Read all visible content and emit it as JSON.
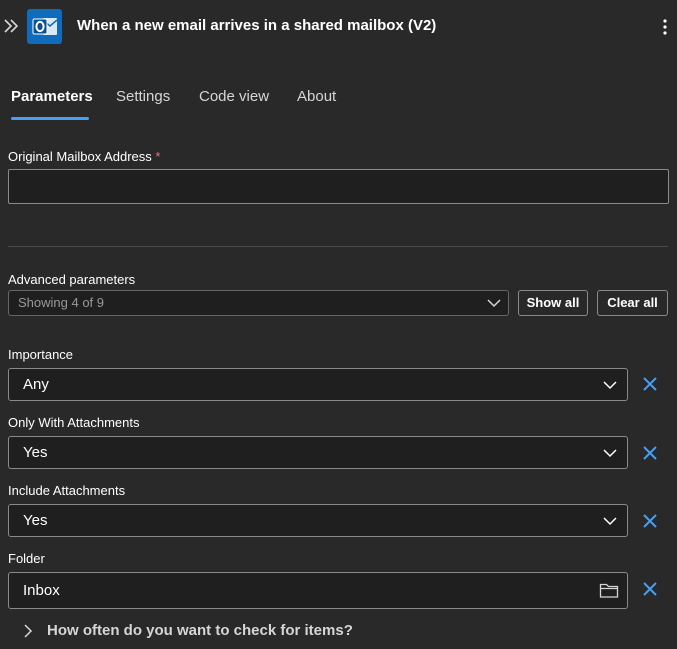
{
  "header": {
    "title": "When a new email arrives in a shared mailbox (V2)",
    "icons": {
      "collapse": "double-chevron-right-icon",
      "app": "outlook-icon",
      "more": "more-vertical-icon"
    }
  },
  "tabs": [
    {
      "label": "Parameters",
      "active": true
    },
    {
      "label": "Settings",
      "active": false
    },
    {
      "label": "Code view",
      "active": false
    },
    {
      "label": "About",
      "active": false
    }
  ],
  "mailbox": {
    "label": "Original Mailbox Address",
    "required_mark": "*",
    "value": ""
  },
  "advanced": {
    "label": "Advanced parameters",
    "selector_text": "Showing 4 of 9",
    "show_all": "Show all",
    "clear_all": "Clear all"
  },
  "params": [
    {
      "label": "Importance",
      "value": "Any",
      "control": "dropdown"
    },
    {
      "label": "Only With Attachments",
      "value": "Yes",
      "control": "dropdown"
    },
    {
      "label": "Include Attachments",
      "value": "Yes",
      "control": "dropdown"
    },
    {
      "label": "Folder",
      "value": "Inbox",
      "control": "folder-picker"
    }
  ],
  "expander": {
    "label": "How often do you want to check for items?",
    "icon": "chevron-right-icon"
  },
  "colors": {
    "background": "#292929",
    "accent": "#479ef5",
    "remove_icon": "#479ef5",
    "required": "#f1707b"
  }
}
